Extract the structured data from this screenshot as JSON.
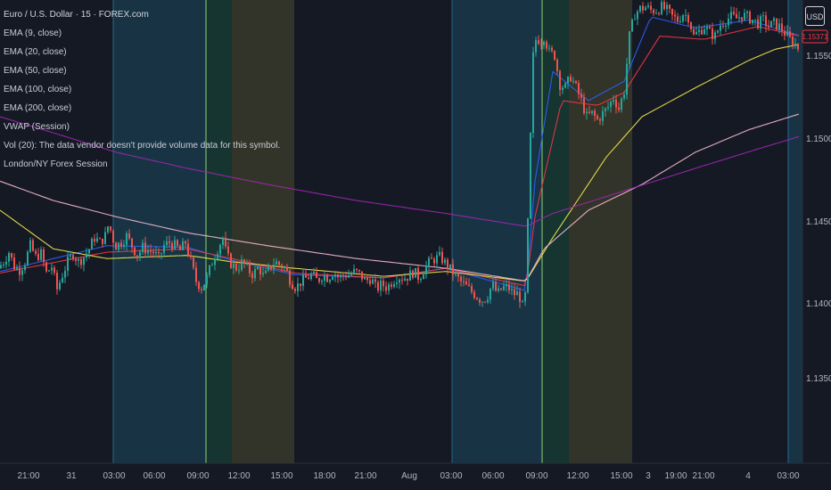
{
  "header": {
    "title": "Euro / U.S. Dollar · 15 · FOREX.com"
  },
  "legend": [
    {
      "label": "EMA (9, close)"
    },
    {
      "label": "EMA (20, close)"
    },
    {
      "label": "EMA (50, close)"
    },
    {
      "label": "EMA (100, close)"
    },
    {
      "label": "EMA (200, close)"
    },
    {
      "label": "VWAP (Session)"
    },
    {
      "label": "Vol (20): The data vendor doesn't provide volume data for this symbol."
    },
    {
      "label": "London/NY Forex Session"
    }
  ],
  "currency_button": "USD",
  "price_badge": "1.15371",
  "colors": {
    "background": "#151924",
    "up": "#26a69a",
    "down": "#ef5350",
    "ema9": "#2962ff",
    "ema20": "#f23645",
    "ema50": "#f5e94a",
    "ema100": "#f8bbd0",
    "ema200": "#9c27b0",
    "london_session": "#1b4a5e",
    "overlap_session": "#174a3a",
    "ny_session": "#4a4a2e"
  },
  "chart_data": {
    "type": "candlestick",
    "symbol": "Euro / U.S. Dollar",
    "interval": "15",
    "y_axis_ticks": [
      "1.15500",
      "1.15000",
      "1.14500",
      "1.14000",
      "1.13500"
    ],
    "ylim": [
      1.1315,
      1.1598
    ],
    "x_axis_ticks": [
      "21:00",
      "31",
      "03:00",
      "06:00",
      "09:00",
      "12:00",
      "15:00",
      "18:00",
      "21:00",
      "Aug",
      "03:00",
      "06:00",
      "09:00",
      "12:00",
      "15:00",
      "3",
      "19:00",
      "21:00",
      "4",
      "03:00"
    ],
    "sessions": [
      {
        "name": "London",
        "start": "03:00",
        "end": "09:00",
        "day": "31"
      },
      {
        "name": "London/NY overlap",
        "start": "09:00",
        "end": "11:00",
        "day": "31"
      },
      {
        "name": "New York",
        "start": "11:00",
        "end": "15:00",
        "day": "31"
      },
      {
        "name": "London",
        "start": "03:00",
        "end": "09:00",
        "day": "Aug 1"
      },
      {
        "name": "London/NY overlap",
        "start": "09:00",
        "end": "11:00",
        "day": "Aug 1"
      },
      {
        "name": "New York",
        "start": "11:00",
        "end": "15:00",
        "day": "Aug 1"
      },
      {
        "name": "London",
        "start": "03:00",
        "end": "",
        "day": "4"
      }
    ],
    "price_path": [
      [
        0,
        1.1436
      ],
      [
        6,
        1.144
      ],
      [
        12,
        1.1446
      ],
      [
        18,
        1.1437
      ],
      [
        24,
        1.1435
      ],
      [
        30,
        1.144
      ],
      [
        36,
        1.145
      ],
      [
        42,
        1.1443
      ],
      [
        48,
        1.1445
      ],
      [
        54,
        1.1433
      ],
      [
        60,
        1.1437
      ],
      [
        66,
        1.1423
      ],
      [
        72,
        1.1432
      ],
      [
        78,
        1.144
      ],
      [
        84,
        1.1445
      ],
      [
        90,
        1.144
      ],
      [
        96,
        1.1443
      ],
      [
        102,
        1.1448
      ],
      [
        108,
        1.1455
      ],
      [
        114,
        1.1452
      ],
      [
        120,
        1.1456
      ],
      [
        124,
        1.1464
      ],
      [
        128,
        1.1455
      ],
      [
        132,
        1.145
      ],
      [
        138,
        1.1452
      ],
      [
        144,
        1.1456
      ],
      [
        150,
        1.145
      ],
      [
        156,
        1.1444
      ],
      [
        162,
        1.1449
      ],
      [
        168,
        1.1447
      ],
      [
        174,
        1.1446
      ],
      [
        180,
        1.1442
      ],
      [
        186,
        1.145
      ],
      [
        192,
        1.1452
      ],
      [
        198,
        1.145
      ],
      [
        204,
        1.1447
      ],
      [
        210,
        1.1452
      ],
      [
        216,
        1.144
      ],
      [
        222,
        1.1428
      ],
      [
        228,
        1.1424
      ],
      [
        234,
        1.143
      ],
      [
        240,
        1.144
      ],
      [
        246,
        1.1448
      ],
      [
        252,
        1.1455
      ],
      [
        256,
        1.1444
      ],
      [
        262,
        1.1438
      ],
      [
        268,
        1.1436
      ],
      [
        274,
        1.144
      ],
      [
        280,
        1.1435
      ],
      [
        286,
        1.1432
      ],
      [
        292,
        1.1437
      ],
      [
        298,
        1.143
      ],
      [
        304,
        1.1436
      ],
      [
        310,
        1.144
      ],
      [
        316,
        1.1438
      ],
      [
        322,
        1.1436
      ],
      [
        328,
        1.1428
      ],
      [
        334,
        1.1424
      ],
      [
        340,
        1.1428
      ],
      [
        346,
        1.143
      ],
      [
        352,
        1.1432
      ],
      [
        358,
        1.1428
      ],
      [
        364,
        1.1432
      ],
      [
        370,
        1.143
      ],
      [
        376,
        1.1434
      ],
      [
        382,
        1.143
      ],
      [
        388,
        1.1432
      ],
      [
        394,
        1.1432
      ],
      [
        400,
        1.1434
      ],
      [
        406,
        1.1432
      ],
      [
        412,
        1.1428
      ],
      [
        418,
        1.143
      ],
      [
        424,
        1.1423
      ],
      [
        430,
        1.1426
      ],
      [
        436,
        1.1424
      ],
      [
        442,
        1.1428
      ],
      [
        448,
        1.1431
      ],
      [
        454,
        1.143
      ],
      [
        460,
        1.1431
      ],
      [
        466,
        1.1434
      ],
      [
        472,
        1.143
      ],
      [
        478,
        1.1436
      ],
      [
        484,
        1.144
      ],
      [
        490,
        1.1442
      ],
      [
        496,
        1.1443
      ],
      [
        500,
        1.144
      ],
      [
        506,
        1.1436
      ],
      [
        512,
        1.1432
      ],
      [
        518,
        1.1428
      ],
      [
        524,
        1.1425
      ],
      [
        530,
        1.1422
      ],
      [
        536,
        1.1419
      ],
      [
        542,
        1.1416
      ],
      [
        548,
        1.1418
      ],
      [
        554,
        1.1426
      ],
      [
        560,
        1.142
      ],
      [
        566,
        1.1424
      ],
      [
        572,
        1.1424
      ],
      [
        578,
        1.142
      ],
      [
        584,
        1.142
      ],
      [
        588,
        1.1412
      ],
      [
        591,
        1.1419
      ],
      [
        594,
        1.1464
      ],
      [
        597,
        1.152
      ],
      [
        600,
        1.157
      ],
      [
        604,
        1.158
      ],
      [
        608,
        1.1576
      ],
      [
        612,
        1.158
      ],
      [
        618,
        1.157
      ],
      [
        624,
        1.1568
      ],
      [
        630,
        1.155
      ],
      [
        636,
        1.1548
      ],
      [
        642,
        1.1555
      ],
      [
        648,
        1.1548
      ],
      [
        654,
        1.154
      ],
      [
        660,
        1.153
      ],
      [
        666,
        1.1532
      ],
      [
        672,
        1.1528
      ],
      [
        678,
        1.1532
      ],
      [
        684,
        1.1536
      ],
      [
        690,
        1.1542
      ],
      [
        696,
        1.1535
      ],
      [
        702,
        1.1546
      ],
      [
        708,
        1.158
      ],
      [
        714,
        1.1594
      ],
      [
        720,
        1.1597
      ],
      [
        726,
        1.1598
      ],
      [
        732,
        1.1596
      ],
      [
        738,
        1.1596
      ],
      [
        744,
        1.1598
      ],
      [
        750,
        1.1596
      ],
      [
        756,
        1.1592
      ],
      [
        762,
        1.159
      ],
      [
        768,
        1.1594
      ],
      [
        774,
        1.1592
      ],
      [
        780,
        1.158
      ],
      [
        786,
        1.1583
      ],
      [
        792,
        1.1586
      ],
      [
        798,
        1.1582
      ],
      [
        804,
        1.158
      ],
      [
        810,
        1.1587
      ],
      [
        816,
        1.159
      ],
      [
        822,
        1.1592
      ],
      [
        828,
        1.1591
      ],
      [
        834,
        1.1593
      ],
      [
        840,
        1.1592
      ],
      [
        846,
        1.159
      ],
      [
        852,
        1.1588
      ],
      [
        858,
        1.159
      ],
      [
        864,
        1.1586
      ],
      [
        870,
        1.1588
      ],
      [
        876,
        1.1586
      ],
      [
        882,
        1.1582
      ],
      [
        888,
        1.1578
      ],
      [
        894,
        1.1575
      ],
      [
        898,
        1.1572
      ]
    ],
    "series": [
      {
        "name": "EMA (9, close)",
        "color": "#2962ff",
        "points": [
          [
            0,
            1.1434
          ],
          [
            120,
            1.145
          ],
          [
            210,
            1.1449
          ],
          [
            260,
            1.1441
          ],
          [
            330,
            1.1432
          ],
          [
            430,
            1.143
          ],
          [
            500,
            1.1436
          ],
          [
            590,
            1.1422
          ],
          [
            600,
            1.149
          ],
          [
            620,
            1.1558
          ],
          [
            660,
            1.154
          ],
          [
            700,
            1.1552
          ],
          [
            730,
            1.1592
          ],
          [
            780,
            1.1585
          ],
          [
            840,
            1.159
          ],
          [
            898,
            1.158
          ]
        ]
      },
      {
        "name": "EMA (20, close)",
        "color": "#f23645",
        "points": [
          [
            0,
            1.1433
          ],
          [
            120,
            1.1446
          ],
          [
            210,
            1.1448
          ],
          [
            260,
            1.1442
          ],
          [
            330,
            1.1433
          ],
          [
            430,
            1.143
          ],
          [
            500,
            1.1436
          ],
          [
            590,
            1.1425
          ],
          [
            600,
            1.1468
          ],
          [
            630,
            1.154
          ],
          [
            670,
            1.1537
          ],
          [
            700,
            1.1545
          ],
          [
            740,
            1.158
          ],
          [
            790,
            1.1578
          ],
          [
            850,
            1.1586
          ],
          [
            898,
            1.158
          ]
        ]
      },
      {
        "name": "EMA (50, close)",
        "color": "#f5e94a",
        "points": [
          [
            0,
            1.1472
          ],
          [
            60,
            1.1448
          ],
          [
            120,
            1.1442
          ],
          [
            210,
            1.1444
          ],
          [
            260,
            1.144
          ],
          [
            330,
            1.1436
          ],
          [
            430,
            1.1431
          ],
          [
            500,
            1.1434
          ],
          [
            590,
            1.1428
          ],
          [
            620,
            1.1455
          ],
          [
            680,
            1.1505
          ],
          [
            720,
            1.153
          ],
          [
            780,
            1.1548
          ],
          [
            840,
            1.1565
          ],
          [
            870,
            1.1572
          ],
          [
            898,
            1.1575
          ]
        ]
      },
      {
        "name": "EMA (100, close)",
        "color": "#f8bbd0",
        "points": [
          [
            0,
            1.149
          ],
          [
            60,
            1.1478
          ],
          [
            130,
            1.1468
          ],
          [
            210,
            1.1458
          ],
          [
            300,
            1.145
          ],
          [
            400,
            1.1442
          ],
          [
            500,
            1.1436
          ],
          [
            590,
            1.1428
          ],
          [
            610,
            1.1448
          ],
          [
            660,
            1.1472
          ],
          [
            720,
            1.1488
          ],
          [
            780,
            1.1508
          ],
          [
            840,
            1.1522
          ],
          [
            898,
            1.1532
          ]
        ]
      },
      {
        "name": "EMA (200, close)",
        "color": "#9c27b0",
        "points": [
          [
            0,
            1.153
          ],
          [
            60,
            1.152
          ],
          [
            130,
            1.1508
          ],
          [
            210,
            1.1498
          ],
          [
            300,
            1.1488
          ],
          [
            400,
            1.1478
          ],
          [
            500,
            1.147
          ],
          [
            590,
            1.1462
          ],
          [
            620,
            1.147
          ],
          [
            700,
            1.1484
          ],
          [
            780,
            1.1498
          ],
          [
            850,
            1.151
          ],
          [
            898,
            1.1518
          ]
        ]
      }
    ]
  }
}
